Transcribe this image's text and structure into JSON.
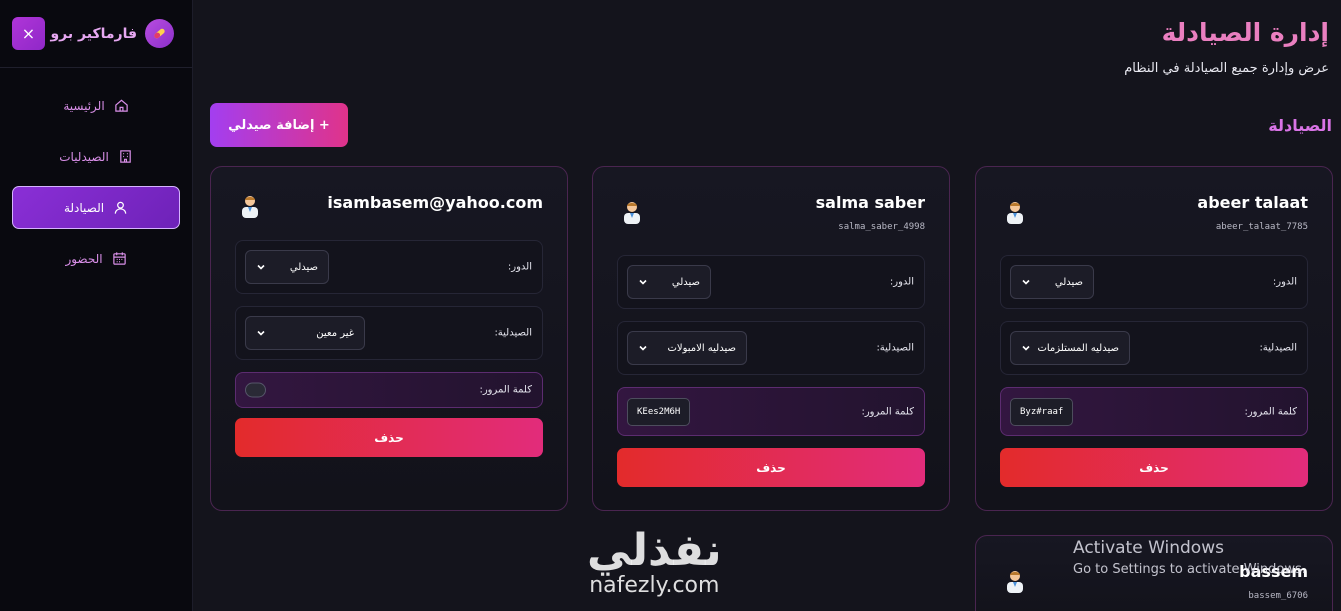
{
  "brand": {
    "name": "فارماكير برو",
    "close_icon": "×"
  },
  "nav": [
    {
      "label": "الرئيسية",
      "icon": "home-icon",
      "active": false
    },
    {
      "label": "الصيدليات",
      "icon": "building-icon",
      "active": false
    },
    {
      "label": "الصيادلة",
      "icon": "user-icon",
      "active": true
    },
    {
      "label": "الحضور",
      "icon": "calendar-icon",
      "active": false
    }
  ],
  "header": {
    "title": "إدارة الصيادلة",
    "subtitle": "عرض وإدارة جميع الصيادلة في النظام"
  },
  "add_button": "+ إضافة صيدلي",
  "section_title": "الصيادلة",
  "labels": {
    "role": "الدور:",
    "pharmacy": "الصيدلية:",
    "password": "كلمة المرور:",
    "delete": "حذف"
  },
  "pharmacists": [
    {
      "name": "abeer talaat",
      "username": "abeer_talaat_7785",
      "role": "صيدلي",
      "pharmacy": "صيدليه المستلزمات",
      "password": "Byz#raaf"
    },
    {
      "name": "salma saber",
      "username": "salma_saber_4998",
      "role": "صيدلي",
      "pharmacy": "صيدليه الامبولات",
      "password": "KEes2M6H"
    },
    {
      "name": "isambasem@yahoo.com",
      "username": "",
      "role": "صيدلي",
      "pharmacy": "غير معين",
      "password": ""
    },
    {
      "name": "bassem",
      "username": "bassem_6706"
    }
  ],
  "overlays": {
    "activate_title": "Activate Windows",
    "activate_sub": "Go to Settings to activate Windows.",
    "logo_ar": "نفذلي",
    "logo_en": "nafezly.com"
  },
  "colors": {
    "accent": "#a33ef0",
    "danger": "#e32b2b",
    "title": "#ea7fc0"
  }
}
